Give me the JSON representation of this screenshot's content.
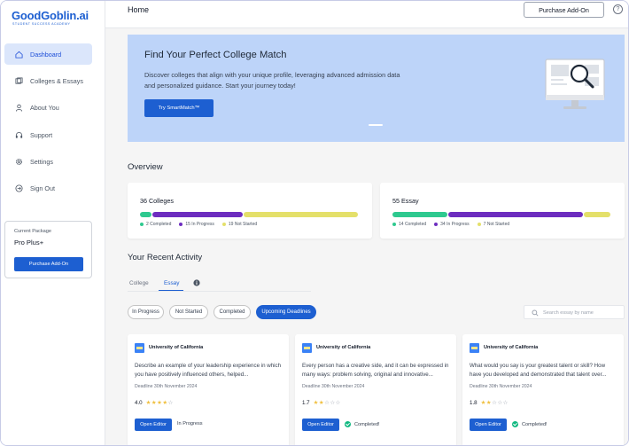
{
  "app": {
    "logo": "GoodGoblin.ai",
    "tagline": "STUDENT SUCCESS ACADEMY",
    "page_title": "Home",
    "purchase_label": "Purchase Add-On",
    "help_glyph": "?"
  },
  "sidebar": {
    "items": [
      {
        "label": "Dashboard",
        "icon": "home-icon",
        "active": true
      },
      {
        "label": "Colleges & Essays",
        "icon": "colleges-icon"
      },
      {
        "label": "About You",
        "icon": "user-icon"
      },
      {
        "label": "Support",
        "icon": "headset-icon"
      },
      {
        "label": "Settings",
        "icon": "gear-icon"
      },
      {
        "label": "Sign Out",
        "icon": "sign-out-icon"
      }
    ],
    "package": {
      "label": "Current Package",
      "name": "Pro Plus+",
      "button": "Purchase Add-On"
    }
  },
  "hero": {
    "title": "Find Your Perfect College Match",
    "description": "Discover colleges that align with your unique profile, leveraging advanced admission data and personalized guidance. Start your journey today!",
    "button": "Try SmartMatch™"
  },
  "overview": {
    "title": "Overview",
    "cards": [
      {
        "title": "36 Colleges",
        "segments": [
          {
            "label": "2 Completed",
            "value": 2,
            "color": "#2ec98f"
          },
          {
            "label": "15 In Progress",
            "value": 15,
            "color": "#6d2dbf"
          },
          {
            "label": "19 Not Started",
            "value": 19,
            "color": "#e4e06a"
          }
        ]
      },
      {
        "title": "55 Essay",
        "segments": [
          {
            "label": "14 Completed",
            "value": 14,
            "color": "#2ec98f"
          },
          {
            "label": "34 In Progress",
            "value": 34,
            "color": "#6d2dbf"
          },
          {
            "label": "7 Not Started",
            "value": 7,
            "color": "#e4e06a"
          }
        ]
      }
    ]
  },
  "activity": {
    "title": "Your Recent Activity",
    "tabs": [
      "College",
      "Essay"
    ],
    "active_tab": "Essay",
    "filters": [
      "In Progress",
      "Not Started",
      "Completed",
      "Upcoming Deadlines"
    ],
    "active_filter": "Upcoming Deadlines",
    "search_placeholder": "Search essay by name",
    "cards": [
      {
        "university": "University of California",
        "question": "Describe an example of your leadership experience in which you have positively influenced others, helped...",
        "deadline": "Deadline 30th November 2024",
        "rating": "4.0",
        "stars": 4,
        "button": "Open Editor",
        "status": "In Progress",
        "completed": false
      },
      {
        "university": "University of California",
        "question": "Every person has a creative side, and it can be expressed in many ways: problem solving, original and innovative...",
        "deadline": "Deadline 30th November 2024",
        "rating": "1.7",
        "stars": 2,
        "button": "Open Editor",
        "status": "Completed!",
        "completed": true
      },
      {
        "university": "University of California",
        "question": "What would you say is your greatest talent or skill? How have you developed and demonstrated that talent over...",
        "deadline": "Deadline 30th November 2024",
        "rating": "1.8",
        "stars": 2,
        "button": "Open Editor",
        "status": "Completed!",
        "completed": true
      }
    ]
  }
}
